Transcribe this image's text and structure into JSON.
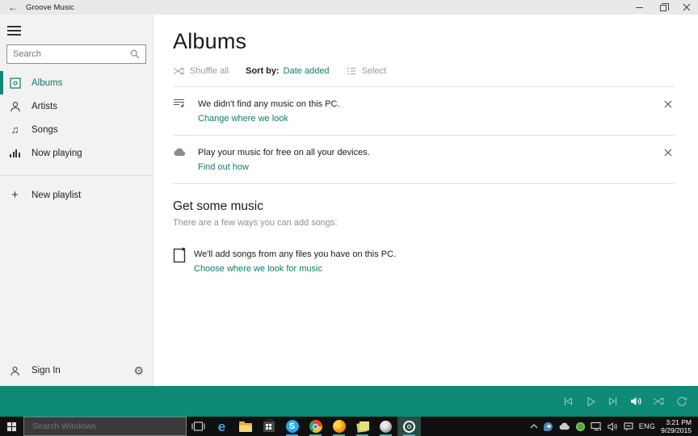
{
  "colors": {
    "accent": "#0E8A76",
    "link": "#0F7B6B",
    "sidebar_bg": "#f2f2f2",
    "titlebar_bg": "#e9e9e9",
    "taskbar_bg": "#101010"
  },
  "titlebar": {
    "title": "Groove Music"
  },
  "icons": {
    "back": "←",
    "songs_note": "♫",
    "new_playlist_plus": "+",
    "gear": "⚙",
    "tray_chevron": "︿"
  },
  "sidebar": {
    "search_placeholder": "Search",
    "items": [
      {
        "label": "Albums",
        "selected": true
      },
      {
        "label": "Artists",
        "selected": false
      },
      {
        "label": "Songs",
        "selected": false
      },
      {
        "label": "Now playing",
        "selected": false
      }
    ],
    "new_playlist": "New playlist",
    "sign_in": "Sign In"
  },
  "main": {
    "title": "Albums",
    "toolbar": {
      "shuffle": "Shuffle all",
      "sort_label": "Sort by:",
      "sort_value": "Date added",
      "select": "Select"
    },
    "notifications": [
      {
        "text": "We didn't find any music on this PC.",
        "link": "Change where we look"
      },
      {
        "text": "Play your music for free on all your devices.",
        "link": "Find out how"
      }
    ],
    "section": {
      "title": "Get some music",
      "subtitle": "There are a few ways you can add songs:",
      "item": {
        "text": "We'll add songs from any files you have on this PC.",
        "link": "Choose where we look for music"
      }
    }
  },
  "player": {
    "controls": [
      "previous",
      "play",
      "next",
      "volume",
      "shuffle",
      "repeat"
    ]
  },
  "taskbar": {
    "search_placeholder": "Search Windows",
    "apps": [
      "task-view",
      "edge",
      "file-explorer",
      "store",
      "skype",
      "chrome",
      "firefox",
      "sticky-notes",
      "game",
      "groove-music"
    ],
    "tray": {
      "language": "ENG",
      "time": "3:21 PM",
      "date": "9/29/2015"
    }
  }
}
